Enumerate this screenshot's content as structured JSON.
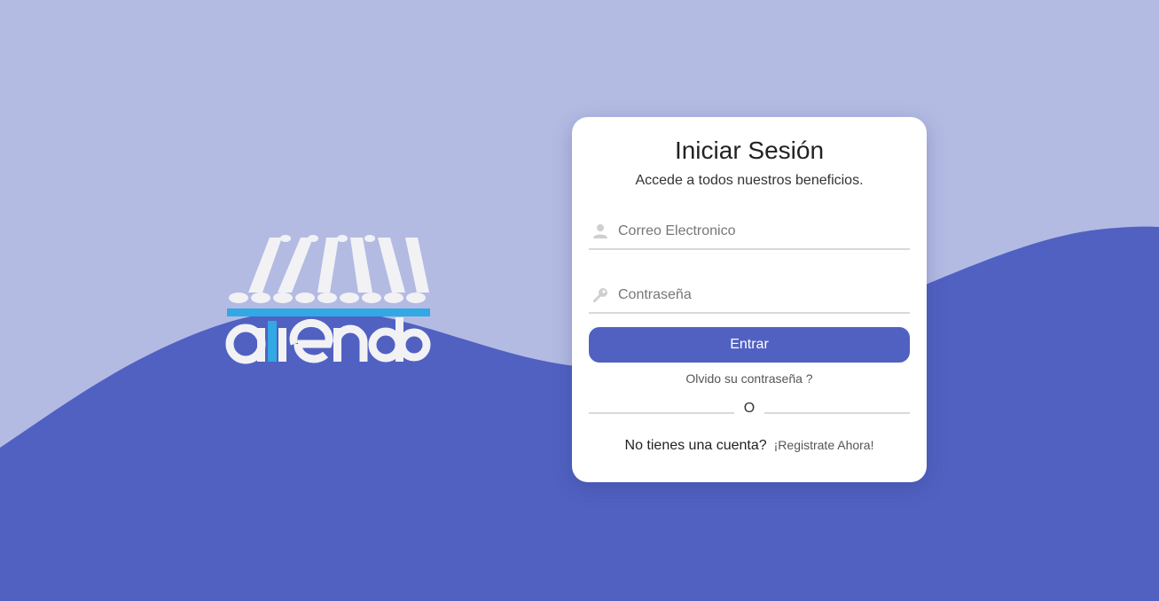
{
  "brand": {
    "logo_text": "aTiendo"
  },
  "login": {
    "title": "Iniciar Sesión",
    "subtitle": "Accede a todos nuestros beneficios.",
    "email": {
      "placeholder": "Correo Electronico",
      "value": "",
      "icon": "user-icon"
    },
    "password": {
      "placeholder": "Contraseña",
      "value": "",
      "icon": "key-icon"
    },
    "submit_label": "Entrar",
    "forgot_label": "Olvido su contraseña ?",
    "divider_label": "O",
    "signup_question": "No tienes una cuenta?",
    "signup_link": "¡Registrate Ahora!"
  },
  "colors": {
    "background_light": "#b3bbe3",
    "background_wave": "#5161c1",
    "button": "#5161c1",
    "logo_accent": "#32a8e4",
    "logo_white": "#f2f2f5"
  }
}
